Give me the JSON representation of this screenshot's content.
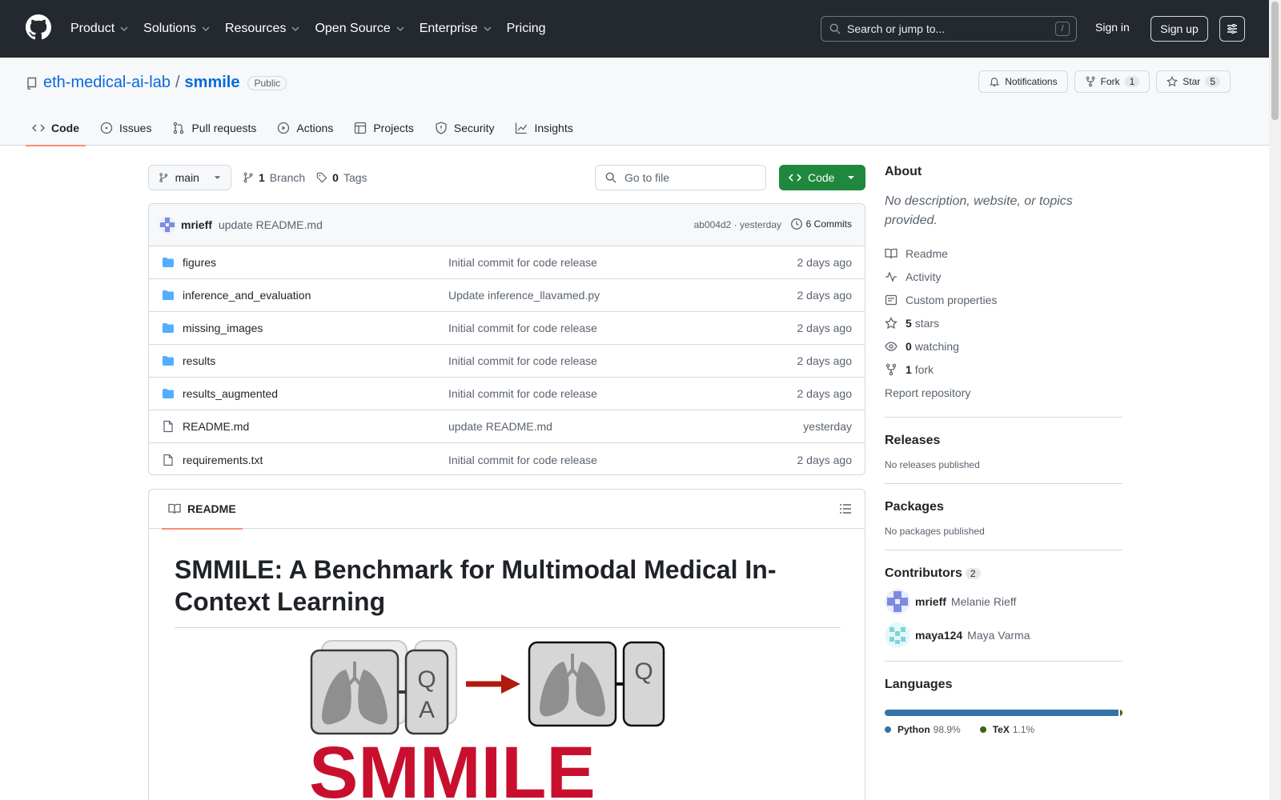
{
  "header": {
    "nav": [
      "Product",
      "Solutions",
      "Resources",
      "Open Source",
      "Enterprise",
      "Pricing"
    ],
    "search_placeholder": "Search or jump to...",
    "search_shortcut": "/",
    "sign_in": "Sign in",
    "sign_up": "Sign up"
  },
  "repo": {
    "owner": "eth-medical-ai-lab",
    "separator": "/",
    "name": "smmile",
    "visibility": "Public",
    "notifications": "Notifications",
    "fork_label": "Fork",
    "fork_count": "1",
    "star_label": "Star",
    "star_count": "5"
  },
  "tabs": [
    "Code",
    "Issues",
    "Pull requests",
    "Actions",
    "Projects",
    "Security",
    "Insights"
  ],
  "toolbar": {
    "branch": "main",
    "branch_count": "1",
    "branch_label": "Branch",
    "tag_count": "0",
    "tag_label": "Tags",
    "goto_placeholder": "Go to file",
    "code_button": "Code"
  },
  "commit": {
    "author": "mrieff",
    "message": "update README.md",
    "meta": "ab004d2 · yesterday",
    "commits": "6 Commits"
  },
  "files": [
    {
      "type": "folder",
      "name": "figures",
      "message": "Initial commit for code release",
      "date": "2 days ago"
    },
    {
      "type": "folder",
      "name": "inference_and_evaluation",
      "message": "Update inference_llavamed.py",
      "date": "2 days ago"
    },
    {
      "type": "folder",
      "name": "missing_images",
      "message": "Initial commit for code release",
      "date": "2 days ago"
    },
    {
      "type": "folder",
      "name": "results",
      "message": "Initial commit for code release",
      "date": "2 days ago"
    },
    {
      "type": "folder",
      "name": "results_augmented",
      "message": "Initial commit for code release",
      "date": "2 days ago"
    },
    {
      "type": "file",
      "name": "README.md",
      "message": "update README.md",
      "date": "yesterday"
    },
    {
      "type": "file",
      "name": "requirements.txt",
      "message": "Initial commit for code release",
      "date": "2 days ago"
    }
  ],
  "readme": {
    "tab_label": "README",
    "title": "SMMILE: A Benchmark for Multimodal Medical In-Context Learning",
    "logo_text": "SMMILE",
    "figure_letters": [
      "Q",
      "A",
      "Q"
    ]
  },
  "sidebar": {
    "about_title": "About",
    "about_desc": "No description, website, or topics provided.",
    "links": [
      {
        "icon": "book-icon",
        "bold": "",
        "text": "Readme"
      },
      {
        "icon": "pulse-icon",
        "bold": "",
        "text": "Activity"
      },
      {
        "icon": "note-icon",
        "bold": "",
        "text": "Custom properties"
      },
      {
        "icon": "star-icon",
        "bold": "5",
        "text": "stars"
      },
      {
        "icon": "eye-icon",
        "bold": "0",
        "text": "watching"
      },
      {
        "icon": "fork-icon",
        "bold": "1",
        "text": "fork"
      }
    ],
    "report": "Report repository",
    "releases_title": "Releases",
    "releases_text": "No releases published",
    "packages_title": "Packages",
    "packages_text": "No packages published",
    "contributors_title": "Contributors",
    "contributors_count": "2",
    "contributors": [
      {
        "login": "mrieff",
        "name": "Melanie Rieff"
      },
      {
        "login": "maya124",
        "name": "Maya Varma"
      }
    ],
    "languages_title": "Languages",
    "languages": [
      {
        "name": "Python",
        "pct": "98.9%",
        "value": 98.9,
        "color": "#3572A5"
      },
      {
        "name": "TeX",
        "pct": "1.1%",
        "value": 1.1,
        "color": "#3D6117"
      }
    ]
  },
  "colors": {
    "header_bg": "#24292f",
    "accent": "#0969da",
    "code_button": "#1f883d",
    "logo_red": "#c8102e",
    "arrow": "#b11a0f"
  }
}
